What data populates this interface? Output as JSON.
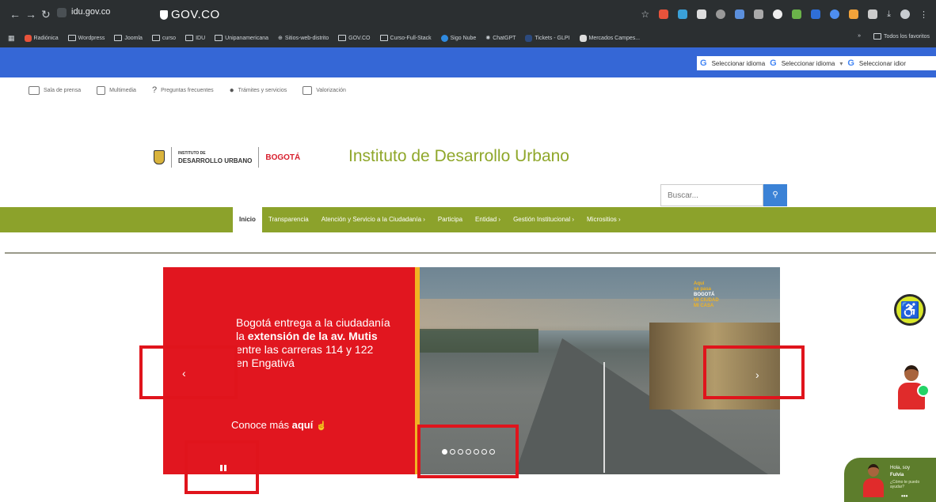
{
  "browser": {
    "url": "idu.gov.co",
    "bookmarks": [
      "Radiónica",
      "Wordpress",
      "Joomla",
      "curso",
      "IDU",
      "Unipanamericana",
      "Sitios-web-distrito",
      "GOV.CO",
      "Curso-Full-Stack",
      "Sigo Nube",
      "ChatGPT",
      "Tickets - GLPI",
      "Mercados Campes..."
    ],
    "bookmarks_more": "»",
    "all_favorites": "Todos los favoritos"
  },
  "govbar": {
    "logo": "GOV.CO",
    "translate": [
      "Seleccionar idioma",
      "Seleccionar idioma",
      "Seleccionar idior"
    ],
    "colors": {
      "bar": "#3567d6"
    }
  },
  "toplinks": [
    "Sala de prensa",
    "Multimedia",
    "Preguntas frecuentes",
    "Trámites y servicios",
    "Valorización"
  ],
  "header": {
    "idu_logo_line1": "INSTITUTO DE",
    "idu_logo_line2": "DESARROLLO URBANO",
    "bogota_logo": "BOGOTÁ",
    "title": "Instituto de Desarrollo Urbano",
    "search_placeholder": "Buscar..."
  },
  "menu": [
    {
      "label": "Inicio",
      "active": true
    },
    {
      "label": "Transparencia"
    },
    {
      "label": "Atención y Servicio a la Ciudadanía ›"
    },
    {
      "label": "Participa"
    },
    {
      "label": "Entidad ›"
    },
    {
      "label": "Gestión Institucional ›"
    },
    {
      "label": "Micrositios ›"
    }
  ],
  "slider": {
    "text_line1": "Bogotá entrega a la ciudadanía",
    "text_line2_prefix": "la ",
    "text_line2_bold": "extensión de la av. Mutis",
    "text_line3": "entre las carreras 114 y 122",
    "text_line4": "en Engativá",
    "cta_prefix": "Conoce más ",
    "cta_bold": "aquí",
    "badge_line1": "Aquí",
    "badge_line2": "se pasa",
    "badge_line3": "BOGOTÁ",
    "badge_line4": "MI CIUDAD",
    "badge_line5": "MI CASA",
    "dot_count": 7,
    "active_dot": 0,
    "colors": {
      "red": "#e1161f",
      "stripe": "#f0b323"
    }
  },
  "chat": {
    "greeting": "Hola, soy",
    "name": "Fulvia",
    "question_line1": "¿Cómo te puedo",
    "question_line2": "ayudar?",
    "more": "•••"
  },
  "colors": {
    "menu_green": "#8ca22b",
    "title_green": "#8fa72a",
    "annotation_red": "#e0141c"
  }
}
